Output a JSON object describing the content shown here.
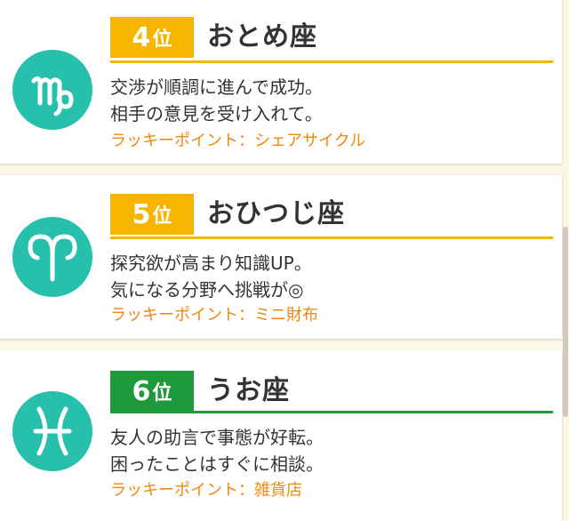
{
  "colors": {
    "teal": "#26c0ac",
    "yellow": "#f7b500",
    "green": "#1e9a3c",
    "orange": "#f0880f",
    "background": "#fbf8e6"
  },
  "cards": [
    {
      "rank_num": "4",
      "rank_suffix": "位",
      "sign": "おとめ座",
      "icon": "virgo-icon",
      "line1": "交渉が順調に進んで成功。",
      "line2": "相手の意見を受け入れて。",
      "lucky": "ラッキーポイント：シェアサイクル"
    },
    {
      "rank_num": "5",
      "rank_suffix": "位",
      "sign": "おひつじ座",
      "icon": "aries-icon",
      "line1": "探究欲が高まり知識UP。",
      "line2": "気になる分野へ挑戦が◎",
      "lucky": "ラッキーポイント：ミニ財布"
    },
    {
      "rank_num": "6",
      "rank_suffix": "位",
      "sign": "うお座",
      "icon": "pisces-icon",
      "line1": "友人の助言で事態が好転。",
      "line2": "困ったことはすぐに相談。",
      "lucky": "ラッキーポイント：雑貨店"
    }
  ]
}
